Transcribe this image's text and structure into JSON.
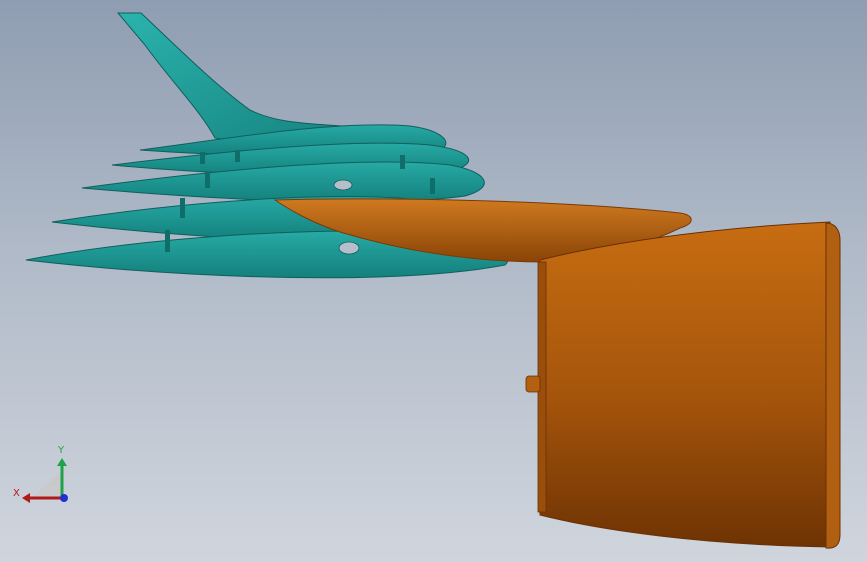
{
  "viewport": {
    "colors": {
      "background_top": "#8f9db2",
      "background_bottom": "#d0d5dd",
      "fin_surface": "#1e9a96",
      "fin_edge": "#0f5f5d",
      "engine_surface": "#b8620e",
      "engine_shadow": "#7a3a06"
    }
  },
  "model": {
    "parts": [
      {
        "name": "vertical-fin"
      },
      {
        "name": "wing-plate-stack",
        "count": 5
      },
      {
        "name": "engine-pylon"
      },
      {
        "name": "engine-nacelle"
      }
    ]
  },
  "triad": {
    "y_label": "Y",
    "x_label": "X",
    "colors": {
      "y": "#1fa24a",
      "x": "#b01a1a",
      "z": "#1f2fd0"
    }
  }
}
